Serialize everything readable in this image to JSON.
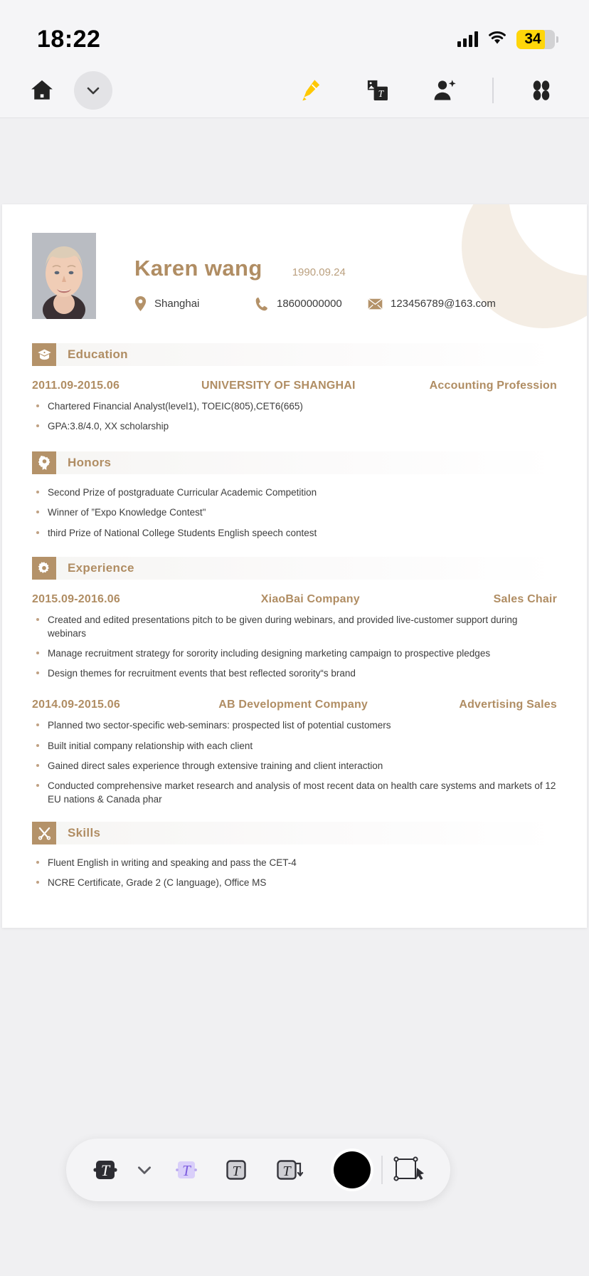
{
  "status_bar": {
    "time": "18:22",
    "battery_level": "34",
    "icons": [
      "cellular-signal-icon",
      "wifi-icon",
      "battery-icon"
    ]
  },
  "app_bar": {
    "left_items": [
      {
        "name": "home-icon",
        "label": "Home"
      },
      {
        "name": "chevron-down-icon",
        "label": "Expand"
      }
    ],
    "right_items": [
      {
        "name": "highlighter-pen-icon",
        "label": "Highlighter"
      },
      {
        "name": "image-to-text-icon",
        "label": "Image Text"
      },
      {
        "name": "ai-photo-enhance-icon",
        "label": "AI Enhance"
      },
      {
        "name": "grid-apps-icon",
        "label": "Apps"
      }
    ]
  },
  "resume": {
    "name": "Karen wang",
    "birth_date": "1990.09.24",
    "contacts": [
      {
        "icon": "location-pin-icon",
        "value": "Shanghai"
      },
      {
        "icon": "phone-icon",
        "value": "18600000000"
      },
      {
        "icon": "envelope-icon",
        "value": "123456789@163.com"
      }
    ],
    "sections": [
      {
        "id": "education",
        "icon": "graduation-cap-icon",
        "title": "Education",
        "entries": [
          {
            "date": "2011.09-2015.06",
            "org": "UNIVERSITY OF SHANGHAI",
            "role": "Accounting Profession",
            "bullets": [
              "Chartered Financial Analyst(level1), TOEIC(805),CET6(665)",
              "GPA:3.8/4.0, XX scholarship"
            ]
          }
        ]
      },
      {
        "id": "honors",
        "icon": "award-ribbon-icon",
        "title": "Honors",
        "entries": [
          {
            "date": "",
            "org": "",
            "role": "",
            "bullets": [
              "Second Prize of postgraduate Curricular Academic Competition",
              "Winner of ”Expo Knowledge Contest\"",
              "third Prize of National College Students  English speech contest"
            ]
          }
        ]
      },
      {
        "id": "experience",
        "icon": "gear-icon",
        "title": "Experience",
        "entries": [
          {
            "date": "2015.09-2016.06",
            "org": "XiaoBai Company",
            "role": "Sales Chair",
            "bullets": [
              "Created and edited presentations pitch to be given during webinars, and provided live-customer support during webinars",
              "Manage recruitment strategy for sorority including designing marketing campaign to prospective pledges",
              "Design themes for recruitment events that best reflected sorority“s brand"
            ]
          },
          {
            "date": "2014.09-2015.06",
            "org": "AB Development Company",
            "role": "Advertising  Sales",
            "bullets": [
              "Planned two sector-specific web-seminars: prospected list of potential customers",
              "Built initial company relationship with each client",
              "Gained direct sales experience through extensive training and client interaction",
              "Conducted comprehensive market research and analysis of most recent data on health care systems and markets of 12 EU nations & Canada phar"
            ]
          }
        ]
      },
      {
        "id": "skills",
        "icon": "tools-cross-icon",
        "title": "Skills",
        "entries": [
          {
            "date": "",
            "org": "",
            "role": "",
            "bullets": [
              " Fluent English in writing and speaking and pass the CET-4",
              "NCRE Certificate, Grade 2 (C language), Office MS"
            ]
          }
        ]
      }
    ]
  },
  "bottom_toolbar": {
    "items": [
      {
        "name": "text-box-selected-icon",
        "label": "Text box"
      },
      {
        "name": "chevron-down-icon",
        "label": "More styles"
      },
      {
        "name": "text-style-purple-icon",
        "label": "Highlight text"
      },
      {
        "name": "text-outline-icon",
        "label": "Outline text"
      },
      {
        "name": "text-wrap-icon",
        "label": "Wrap text"
      },
      {
        "name": "color-swatch-icon",
        "label": "Color"
      },
      {
        "name": "transform-text-icon",
        "label": "Transform"
      }
    ],
    "selected_color": "#000000"
  },
  "colors": {
    "accent": "#b08d63",
    "section_icon_bg": "#b49269",
    "battery_yellow": "#FFD60A",
    "purple_accent": "#7c5cde"
  }
}
